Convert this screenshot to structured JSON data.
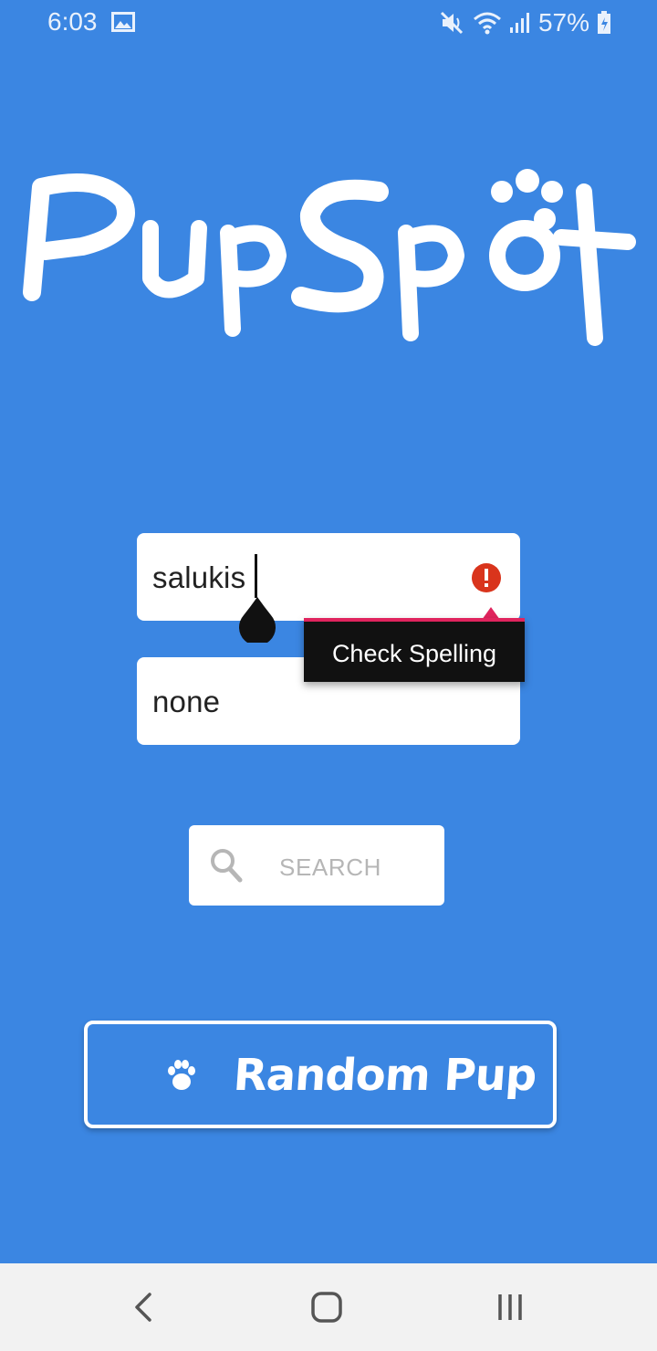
{
  "status_bar": {
    "time": "6:03",
    "battery_percent": "57%",
    "icons": [
      "gallery-icon",
      "mute-icon",
      "wifi-icon",
      "signal-icon",
      "battery-icon"
    ]
  },
  "app": {
    "logo_text": "PupSpot",
    "accent_color": "#3b86e2"
  },
  "form": {
    "breed_value": "salukis",
    "sub_breed_value": "none",
    "error_tooltip": "Check Spelling",
    "search_label": "SEARCH"
  },
  "random_button": {
    "label": "Random Pup"
  },
  "nav_bar": {
    "icons": [
      "back-icon",
      "home-icon",
      "recents-icon"
    ]
  }
}
